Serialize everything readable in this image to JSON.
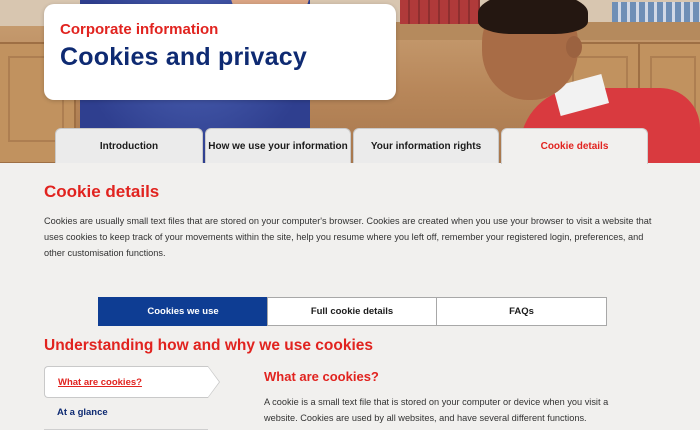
{
  "header": {
    "eyebrow": "Corporate information",
    "title": "Cookies and privacy"
  },
  "tabs": [
    {
      "label": "Introduction",
      "active": false
    },
    {
      "label": "How we use your information",
      "active": false
    },
    {
      "label": "Your information rights",
      "active": false
    },
    {
      "label": "Cookie details",
      "active": true
    }
  ],
  "main": {
    "title": "Cookie details",
    "intro": "Cookies are usually small text files that are stored on your computer's browser. Cookies are created when you use your browser to visit a website that uses cookies to keep track of your movements within the site, help you resume where you left off, remember your registered login, preferences, and other customisation functions."
  },
  "subtabs": [
    {
      "label": "Cookies we use",
      "active": true
    },
    {
      "label": "Full cookie details",
      "active": false
    },
    {
      "label": "FAQs",
      "active": false
    }
  ],
  "section": {
    "title": "Understanding how and why we use cookies",
    "sidebar": {
      "active_item": "What are cookies?",
      "items": [
        "At a glance"
      ]
    },
    "content": {
      "heading": "What are cookies?",
      "body": "A cookie is a small text file that is stored on your computer or device when you visit a website. Cookies are used by all websites, and have several different functions."
    }
  },
  "colors": {
    "brand_red": "#e1231f",
    "brand_navy": "#0e2a72",
    "active_subtab": "#0e3d93",
    "background": "#f1f0ee"
  }
}
